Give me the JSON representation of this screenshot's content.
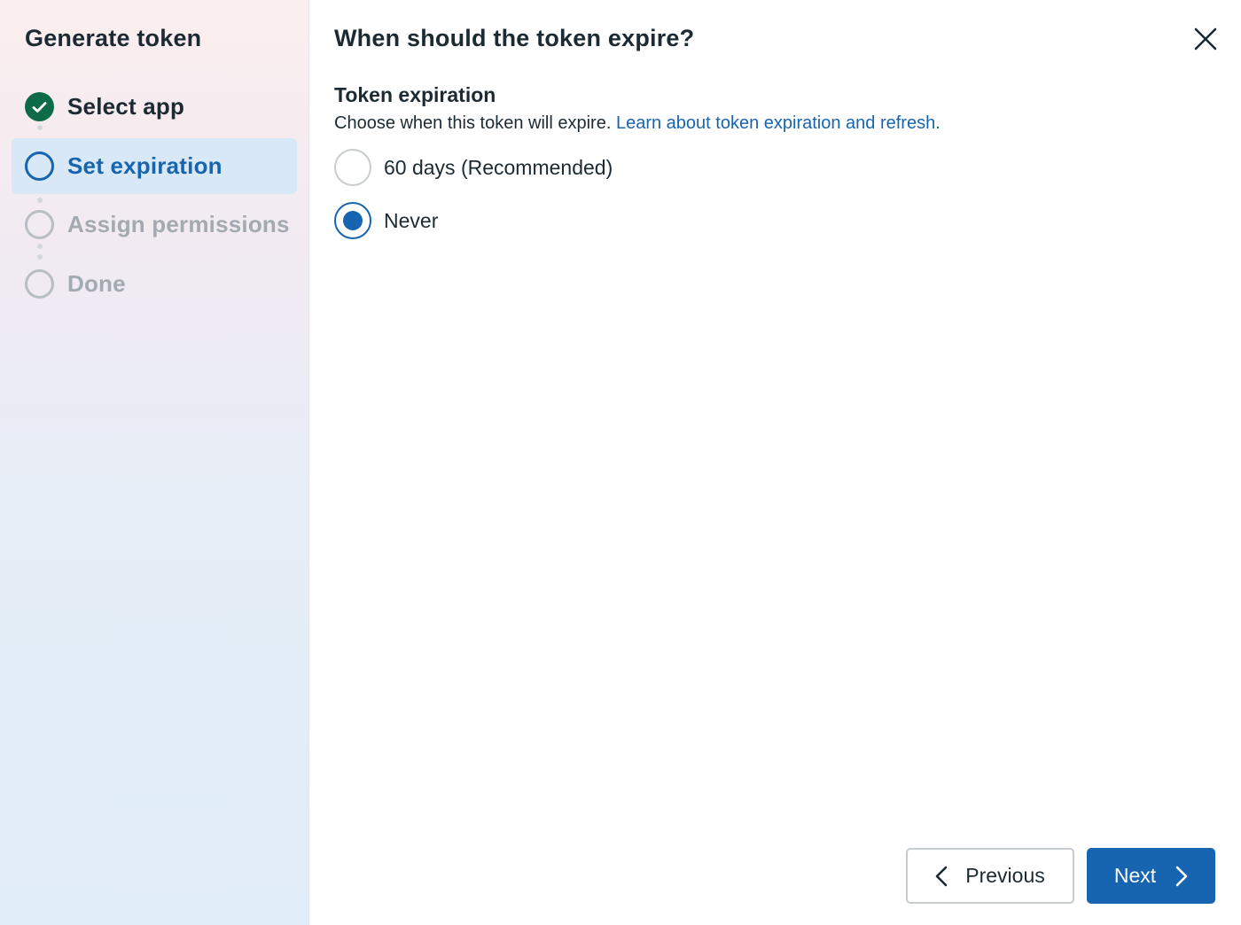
{
  "sidebar": {
    "title": "Generate token",
    "steps": [
      {
        "label": "Select app",
        "state": "done"
      },
      {
        "label": "Set expiration",
        "state": "current"
      },
      {
        "label": "Assign permissions",
        "state": "todo"
      },
      {
        "label": "Done",
        "state": "todo"
      }
    ]
  },
  "main": {
    "title": "When should the token expire?",
    "section": {
      "title": "Token expiration",
      "description": "Choose when this token will expire.",
      "link": "Learn about token expiration and refresh."
    },
    "options": [
      {
        "label": "60 days (Recommended)",
        "selected": false
      },
      {
        "label": "Never",
        "selected": true
      }
    ]
  },
  "footer": {
    "previous_label": "Previous",
    "next_label": "Next"
  },
  "colors": {
    "accent": "#1765b0",
    "success": "#0e6b48",
    "text": "#1c2b33",
    "muted": "#a3aab1"
  },
  "icons": {
    "close": "close-icon",
    "check": "check-icon",
    "previous": "chevron-left-icon",
    "next": "chevron-right-icon"
  }
}
